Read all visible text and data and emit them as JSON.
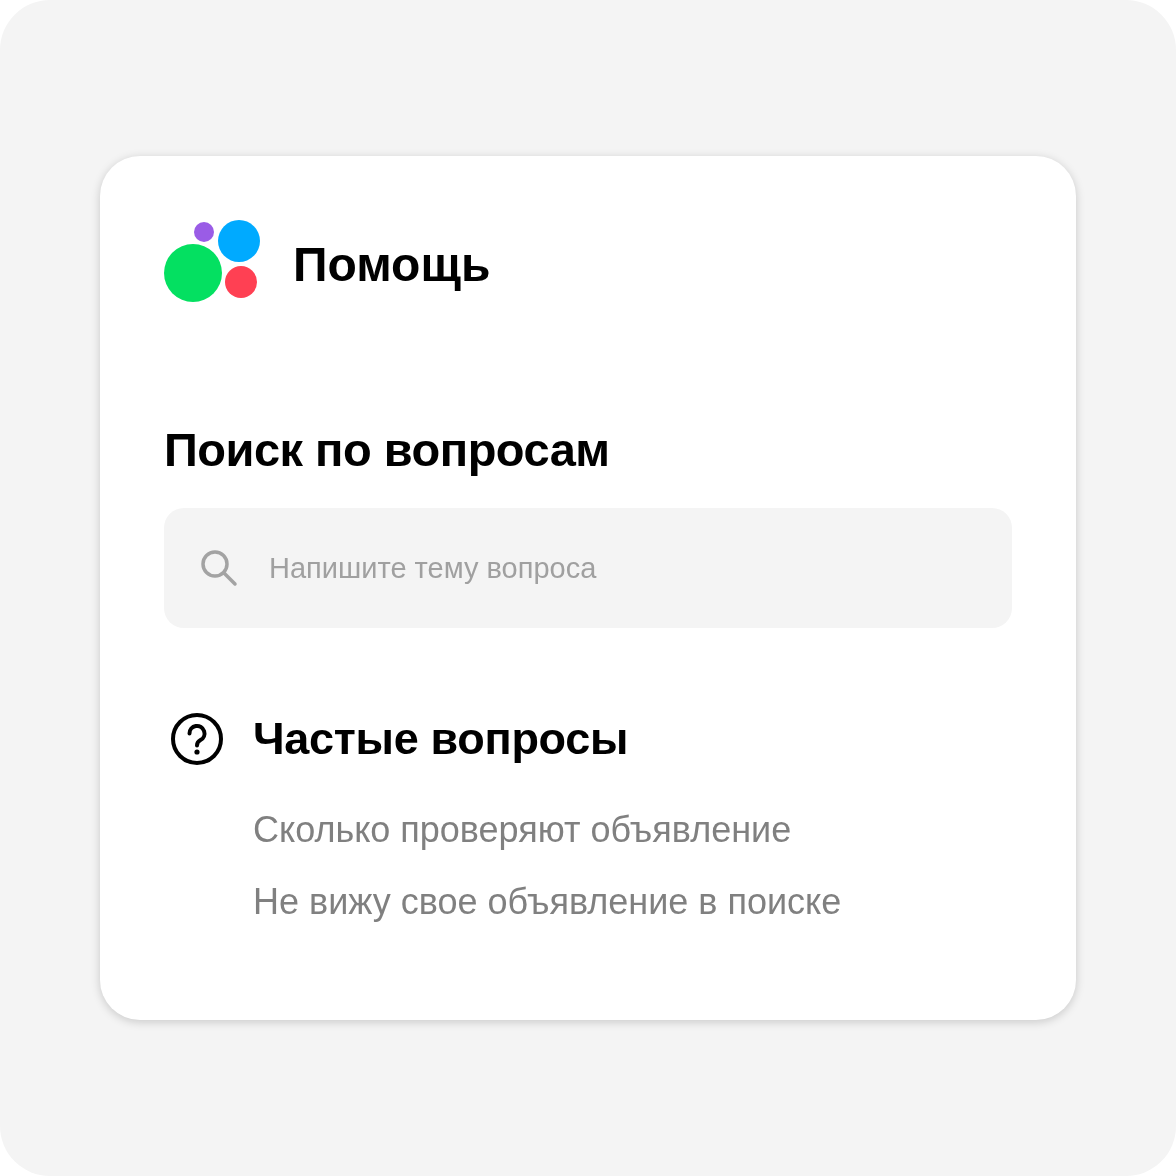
{
  "header": {
    "title": "Помощь"
  },
  "search": {
    "heading": "Поиск по вопросам",
    "placeholder": "Напишите тему вопроса"
  },
  "faq": {
    "heading": "Частые вопросы",
    "items": [
      "Сколько проверяют объявление",
      "Не вижу свое объявление в поиске"
    ]
  }
}
